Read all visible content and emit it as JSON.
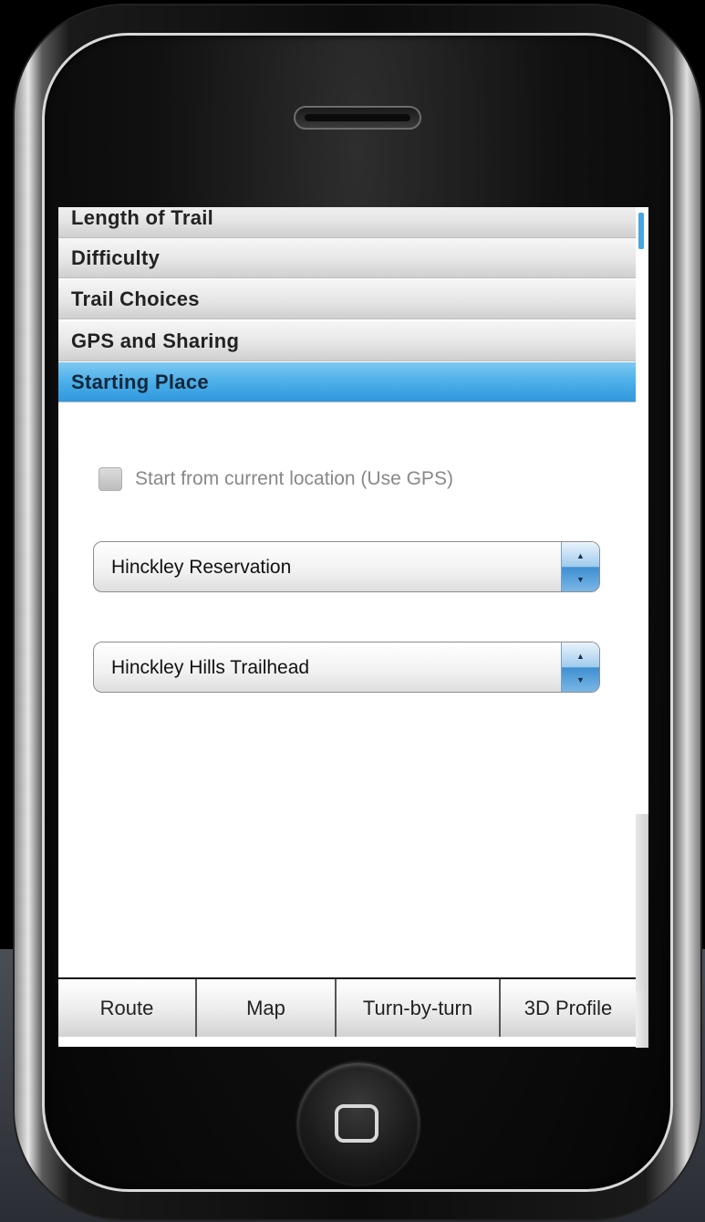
{
  "accordion": {
    "sections": [
      {
        "label": "Length of Trail"
      },
      {
        "label": "Difficulty"
      },
      {
        "label": "Trail Choices"
      },
      {
        "label": "GPS and Sharing"
      },
      {
        "label": "Starting Place"
      }
    ],
    "active_section": "Starting Place"
  },
  "starting_place": {
    "gps_checkbox": {
      "label": "Start from current location (Use GPS)",
      "checked": false,
      "enabled": false
    },
    "reservation_select": {
      "value": "Hinckley Reservation"
    },
    "trailhead_select": {
      "value": "Hinckley Hills Trailhead"
    }
  },
  "tabbar": {
    "tabs": [
      {
        "label": "Route"
      },
      {
        "label": "Map"
      },
      {
        "label": "Turn-by-turn"
      },
      {
        "label": "3D Profile"
      }
    ]
  },
  "icons": {
    "spinner_up": "▲",
    "spinner_down": "▼"
  },
  "colors": {
    "active_header": "#3aa3e4",
    "spinner_blue": "#3f8fd1"
  }
}
